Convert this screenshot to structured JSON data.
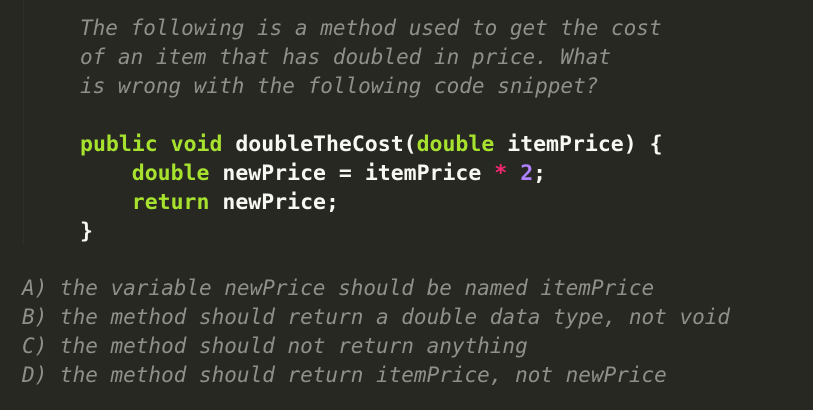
{
  "editor": {
    "background": "#272822",
    "colors": {
      "comment": "#8f908a",
      "keyword": "#a6e22e",
      "text": "#f8f8f2",
      "operator": "#f92672",
      "number": "#ae81ff"
    }
  },
  "question": {
    "lines": [
      "The following is a method used to get the cost",
      "of an item that has doubled in price. What",
      "is wrong with the following code snippet?"
    ]
  },
  "code": {
    "line1": {
      "kw_public": "public",
      "kw_void": "void",
      "method_name": "doubleTheCost",
      "open_paren": "(",
      "param_type": "double",
      "param_name": "itemPrice",
      "close_brace": ") {"
    },
    "line2": {
      "indent": "    ",
      "type": "double",
      "var_name": "newPrice",
      "assign": "=",
      "operand": "itemPrice",
      "multiply": "*",
      "number": "2",
      "semicolon": ";"
    },
    "line3": {
      "indent": "    ",
      "kw_return": "return",
      "value": "newPrice;"
    },
    "line4": {
      "close": "}"
    }
  },
  "answers": [
    "A) the variable newPrice should be named itemPrice",
    "B) the method should return a double data type, not void",
    "C) the method should not return anything",
    "D) the method should return itemPrice, not newPrice"
  ]
}
